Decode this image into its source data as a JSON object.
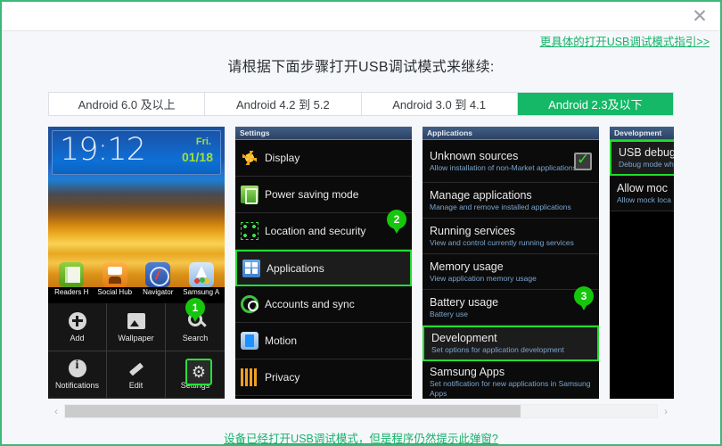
{
  "dialog": {
    "close_label": "✕",
    "guide_link": "更具体的打开USB调试模式指引>>",
    "heading": "请根据下面步骤打开USB调试模式来继续:",
    "footer_link": "设备已经打开USB调试模式，但是程序仍然提示此弹窗?",
    "accent_color": "#3cb878",
    "active_tab_color": "#14b866",
    "link_color": "#17b26a",
    "badge_color": "#16c60c",
    "highlight_color": "#22dd2f"
  },
  "tabs": [
    {
      "label": "Android 6.0 及以上",
      "active": false
    },
    {
      "label": "Android 4.2 到 5.2",
      "active": false
    },
    {
      "label": "Android 3.0 到 4.1",
      "active": false
    },
    {
      "label": "Android 2.3及以下",
      "active": true
    }
  ],
  "scrollbar": {
    "left_arrow": "‹",
    "right_arrow": "›",
    "thumb_percent": 77
  },
  "panels": [
    {
      "id": "home-screen",
      "title": "",
      "clock": {
        "time": "19:12",
        "day": "Fri.",
        "date": "01/18"
      },
      "dock_apps": [
        {
          "label": "Readers H",
          "icon": "readers-hub-icon"
        },
        {
          "label": "Social Hub",
          "icon": "social-hub-icon"
        },
        {
          "label": "Navigator",
          "icon": "navigator-icon"
        },
        {
          "label": "Samsung A",
          "icon": "samsung-apps-icon"
        }
      ],
      "menu_items": [
        {
          "label": "Add",
          "icon": "add-icon",
          "highlighted": false,
          "badge": null
        },
        {
          "label": "Wallpaper",
          "icon": "wallpaper-icon",
          "highlighted": false,
          "badge": null
        },
        {
          "label": "Search",
          "icon": "search-icon",
          "highlighted": false,
          "badge": "1"
        },
        {
          "label": "Notifications",
          "icon": "info-icon",
          "highlighted": false,
          "badge": null
        },
        {
          "label": "Edit",
          "icon": "pencil-icon",
          "highlighted": false,
          "badge": null
        },
        {
          "label": "Settings",
          "icon": "gear-icon",
          "highlighted": true,
          "badge": null
        }
      ]
    },
    {
      "id": "settings",
      "title": "Settings",
      "items": [
        {
          "label": "Display",
          "sub": "",
          "icon": "display-icon",
          "highlighted": false,
          "badge": null
        },
        {
          "label": "Power saving mode",
          "sub": "",
          "icon": "power-saving-icon",
          "highlighted": false,
          "badge": null
        },
        {
          "label": "Location and security",
          "sub": "",
          "icon": "location-security-icon",
          "highlighted": false,
          "badge": "2"
        },
        {
          "label": "Applications",
          "sub": "",
          "icon": "applications-icon",
          "highlighted": true,
          "badge": null
        },
        {
          "label": "Accounts and sync",
          "sub": "",
          "icon": "sync-icon",
          "highlighted": false,
          "badge": null
        },
        {
          "label": "Motion",
          "sub": "",
          "icon": "motion-icon",
          "highlighted": false,
          "badge": null
        },
        {
          "label": "Privacy",
          "sub": "",
          "icon": "privacy-icon",
          "highlighted": false,
          "badge": null
        }
      ]
    },
    {
      "id": "applications",
      "title": "Applications",
      "items": [
        {
          "label": "Unknown sources",
          "sub": "Allow installation of non-Market applications",
          "checkbox": true,
          "checked": true,
          "highlighted": false,
          "badge": null
        },
        {
          "label": "Manage applications",
          "sub": "Manage and remove installed applications",
          "checkbox": false,
          "highlighted": false,
          "badge": null
        },
        {
          "label": "Running services",
          "sub": "View and control currently running services",
          "checkbox": false,
          "highlighted": false,
          "badge": null
        },
        {
          "label": "Memory usage",
          "sub": "View application memory usage",
          "checkbox": false,
          "highlighted": false,
          "badge": null
        },
        {
          "label": "Battery usage",
          "sub": "Battery use",
          "checkbox": false,
          "highlighted": false,
          "badge": "3"
        },
        {
          "label": "Development",
          "sub": "Set options for application development",
          "checkbox": false,
          "highlighted": true,
          "badge": null
        },
        {
          "label": "Samsung Apps",
          "sub": "Set notification for new applications in Samsung Apps",
          "checkbox": false,
          "highlighted": false,
          "badge": null
        }
      ]
    },
    {
      "id": "development",
      "title": "Development",
      "items": [
        {
          "label": "USB debug",
          "sub": "Debug mode wh",
          "highlighted": true,
          "badge": null
        },
        {
          "label": "Allow moc",
          "sub": "Allow mock loca",
          "highlighted": false,
          "badge": null
        }
      ]
    }
  ]
}
